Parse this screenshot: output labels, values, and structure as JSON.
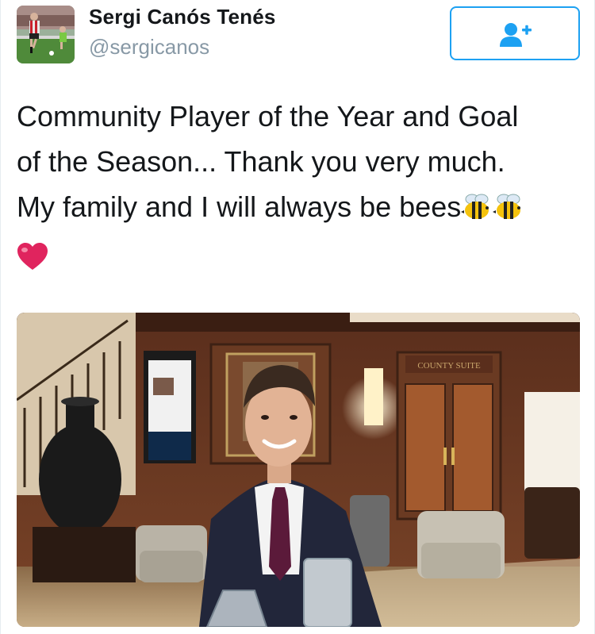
{
  "user": {
    "name": "Sergi Canós Tenés",
    "handle": "@sergicanos",
    "avatar_icon": "profile-photo-football-player"
  },
  "follow_button": {
    "icon": "add-user-icon",
    "accent_color": "#1da1f2"
  },
  "tweet": {
    "text_line1": "Community Player of the Year and Goal",
    "text_line2": "of the Season... Thank you very much.",
    "text_line3": "My family and I will always be bees",
    "emojis": [
      "bee-icon",
      "bee-icon",
      "red-heart-icon"
    ]
  },
  "media": {
    "image": "photo-man-in-suit-with-trophy-hotel-lobby",
    "sign_text": "COUNTY SUITE"
  },
  "colors": {
    "name": "#14171a",
    "handle": "#8899a6",
    "accent": "#1da1f2",
    "heart": "#e0245e"
  }
}
